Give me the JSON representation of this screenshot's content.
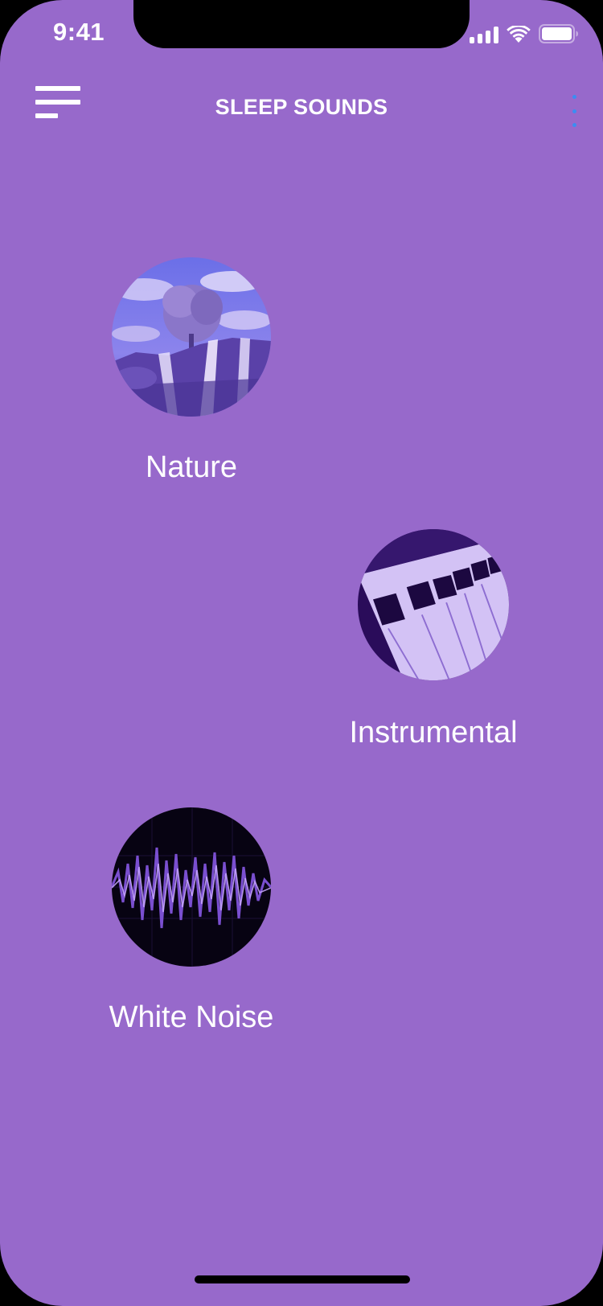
{
  "status_bar": {
    "time": "9:41"
  },
  "header": {
    "title": "SLEEP SOUNDS"
  },
  "categories": [
    {
      "label": "Nature"
    },
    {
      "label": "Instrumental"
    },
    {
      "label": "White Noise"
    }
  ],
  "colors": {
    "background": "#9769cb",
    "text": "#ffffff",
    "more_dots": "#3b8df2"
  },
  "icons": {
    "menu": "menu-icon",
    "more": "more-vertical-icon",
    "signal": "signal-icon",
    "wifi": "wifi-icon",
    "battery": "battery-icon"
  }
}
